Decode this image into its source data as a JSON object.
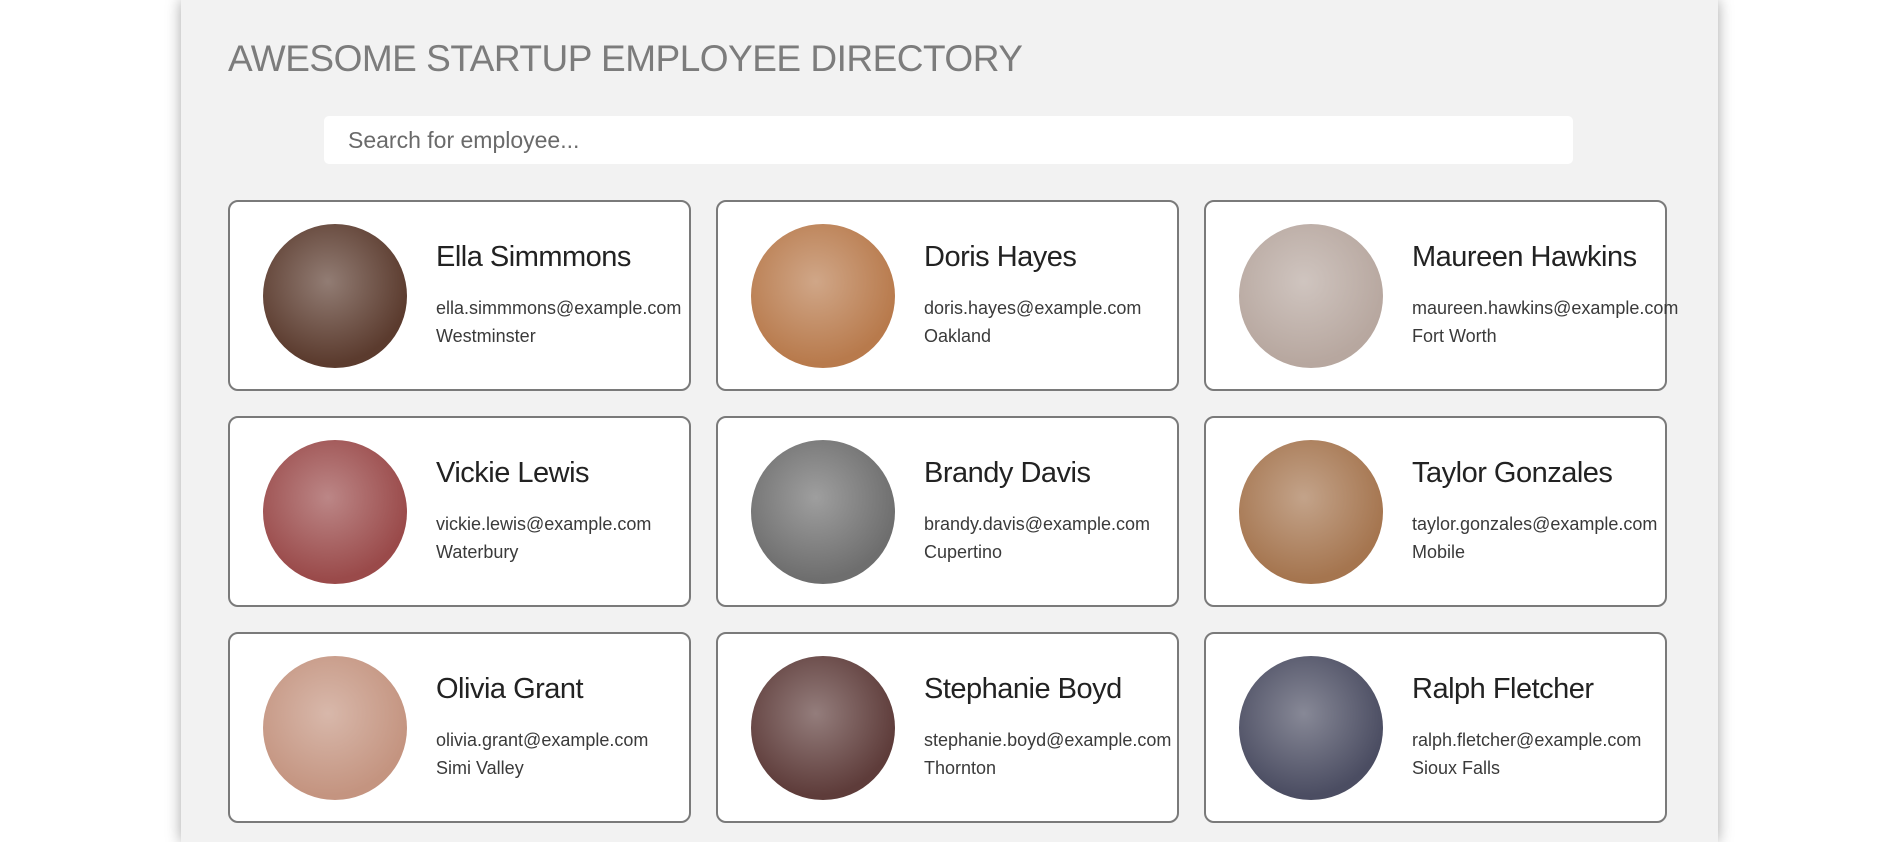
{
  "header": {
    "title": "AWESOME STARTUP EMPLOYEE DIRECTORY"
  },
  "search": {
    "placeholder": "Search for employee..."
  },
  "employees": [
    {
      "name": "Ella Simmmons",
      "email": "ella.simmmons@example.com",
      "city": "Westminster",
      "avatar_color": "#5b3b2e"
    },
    {
      "name": "Doris Hayes",
      "email": "doris.hayes@example.com",
      "city": "Oakland",
      "avatar_color": "#b87a4c"
    },
    {
      "name": "Maureen Hawkins",
      "email": "maureen.hawkins@example.com",
      "city": "Fort Worth",
      "avatar_color": "#b7a79f"
    },
    {
      "name": "Vickie Lewis",
      "email": "vickie.lewis@example.com",
      "city": "Waterbury",
      "avatar_color": "#9a4a4a"
    },
    {
      "name": "Brandy Davis",
      "email": "brandy.davis@example.com",
      "city": "Cupertino",
      "avatar_color": "#6e6e6e"
    },
    {
      "name": "Taylor Gonzales",
      "email": "taylor.gonzales@example.com",
      "city": "Mobile",
      "avatar_color": "#a5754f"
    },
    {
      "name": "Olivia Grant",
      "email": "olivia.grant@example.com",
      "city": "Simi Valley",
      "avatar_color": "#c49480"
    },
    {
      "name": "Stephanie Boyd",
      "email": "stephanie.boyd@example.com",
      "city": "Thornton",
      "avatar_color": "#5e3c3a"
    },
    {
      "name": "Ralph Fletcher",
      "email": "ralph.fletcher@example.com",
      "city": "Sioux Falls",
      "avatar_color": "#4b4d62"
    }
  ]
}
